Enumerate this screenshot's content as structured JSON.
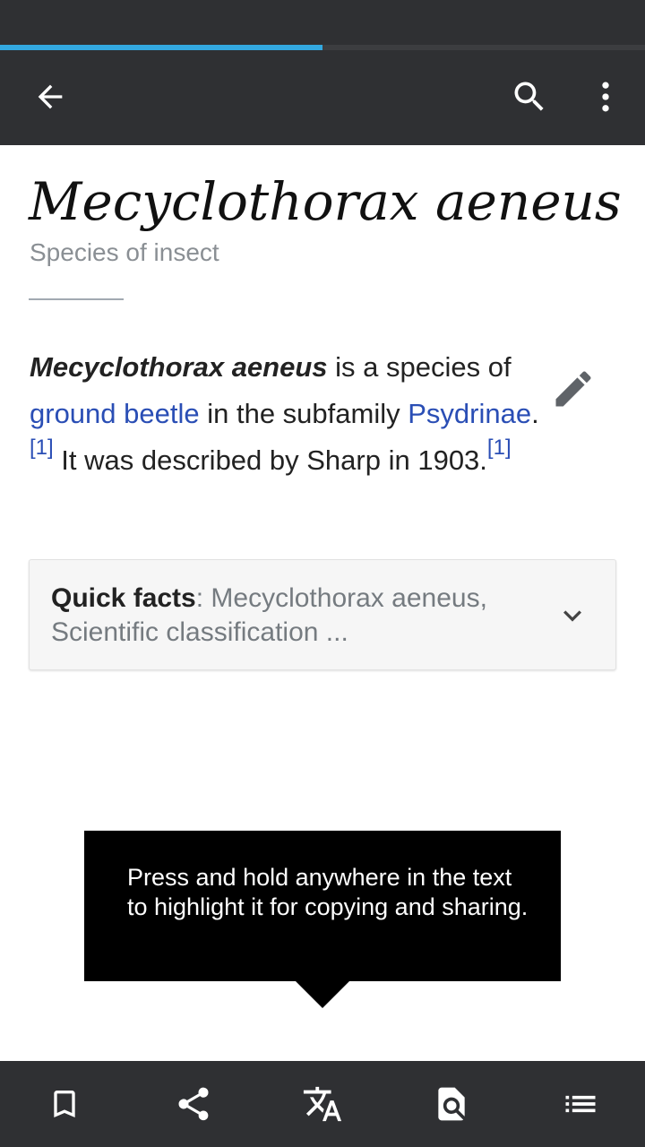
{
  "theme": {
    "bar_color": "#2f3033",
    "progress_color": "#33a8e0",
    "link_color": "#2a4eb5"
  },
  "page_load_progress": 0.5,
  "toolbar": {
    "back_icon": "arrow-left-icon",
    "search_icon": "search-icon",
    "overflow_icon": "more-vert-icon"
  },
  "article": {
    "title": "Mecyclothorax aeneus",
    "description": "Species of insect",
    "lead": {
      "bold_name": "Mecyclothorax aeneus",
      "text_1": " is a species of ",
      "link_1": "ground beetle",
      "text_2": " in the subfamily ",
      "link_2": "Psydrinae",
      "text_3": ".",
      "ref_1": "[1]",
      "text_4": " It was described by Sharp in 1903.",
      "ref_2": "[1]"
    },
    "edit_icon": "pencil-icon"
  },
  "quick_facts": {
    "label": "Quick facts",
    "separator": ": ",
    "summary": "Mecyclothorax aeneus, Scientific classification ...",
    "expand_icon": "chevron-down-icon"
  },
  "tooltip": {
    "text": "Press and hold anywhere in the text to highlight it for copying and sharing."
  },
  "bottom_bar": {
    "icons": [
      "bookmark-icon",
      "share-icon",
      "translate-icon",
      "find-in-page-icon",
      "table-of-contents-icon"
    ]
  }
}
